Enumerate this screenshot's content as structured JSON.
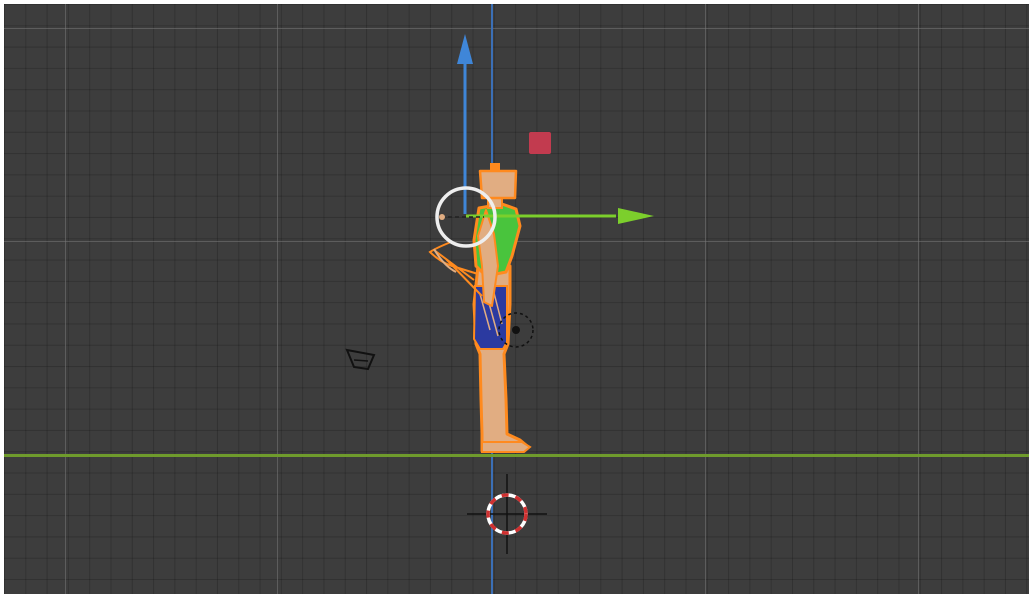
{
  "app": {
    "view": "blender-3d-viewport",
    "projection": "orthographic-side"
  },
  "colors": {
    "background": "#3d3d3d",
    "axis_vertical": "#3b6fb6",
    "axis_horizontal": "#6f9b2c",
    "gizmo_z": "#3f86d8",
    "gizmo_y": "#7ccf2c",
    "gizmo_x_handle": "#c23b4f",
    "selection_outline": "#ff8a1e",
    "skin": "#e1ad82",
    "shirt": "#49c43d",
    "shorts": "#2b3aa0",
    "cursor_red": "#d03030"
  },
  "icons": [
    "transform-gizmo-icon",
    "rotate-handle-icon",
    "3d-cursor-icon",
    "camera-icon",
    "light-icon"
  ]
}
